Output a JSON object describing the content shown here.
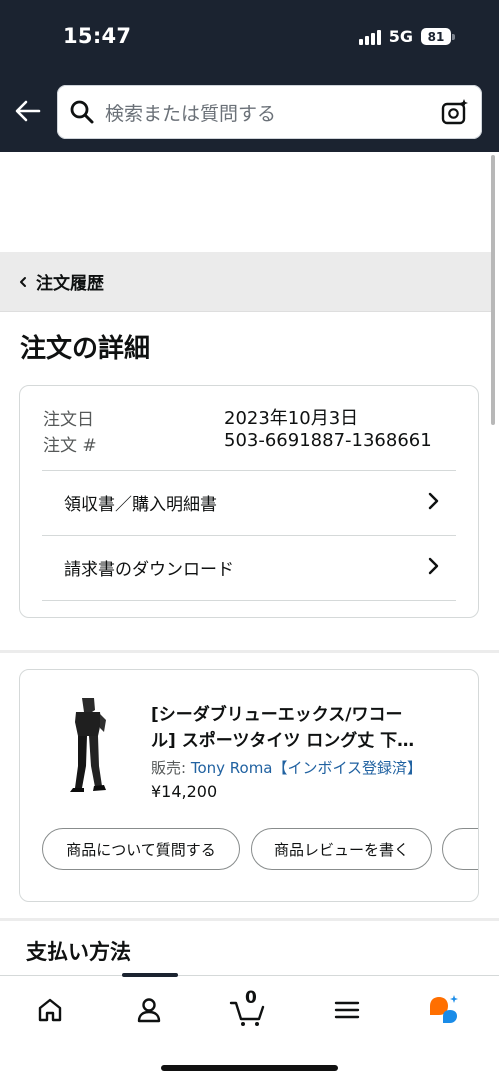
{
  "status_bar": {
    "time": "15:47",
    "network": "5G",
    "battery": "81"
  },
  "search": {
    "placeholder": "検索または質問する"
  },
  "breadcrumb": {
    "label": "注文履歴"
  },
  "page_title": "注文の詳細",
  "order": {
    "date_label": "注文日",
    "date_value": "2023年10月3日",
    "number_label": "注文 #",
    "number_value": "503-6691887-1368661",
    "links": [
      {
        "label": "領収書／購入明細書"
      },
      {
        "label": "請求書のダウンロード"
      }
    ]
  },
  "product": {
    "title_line1": "[シーダブリューエックス/ワコー",
    "title_line2": "ル] スポーツタイツ ロング丈 下…",
    "seller_prefix": "販売: ",
    "seller_name": "Tony Roma【インボイス登録済】",
    "price": "¥14,200",
    "actions": [
      {
        "label": "商品について質問する"
      },
      {
        "label": "商品レビューを書く"
      },
      {
        "label": ""
      }
    ]
  },
  "payment": {
    "title": "支払い方法"
  },
  "bottom_nav": {
    "items": [
      {
        "icon": "home-icon"
      },
      {
        "icon": "account-icon"
      },
      {
        "icon": "cart-icon",
        "badge": "0"
      },
      {
        "icon": "menu-icon"
      },
      {
        "icon": "rufus-icon"
      }
    ]
  },
  "colors": {
    "header_bg": "#1b2330",
    "link": "#2162a1",
    "accent_orange": "#ff6f00",
    "accent_blue": "#1a8ce8"
  }
}
